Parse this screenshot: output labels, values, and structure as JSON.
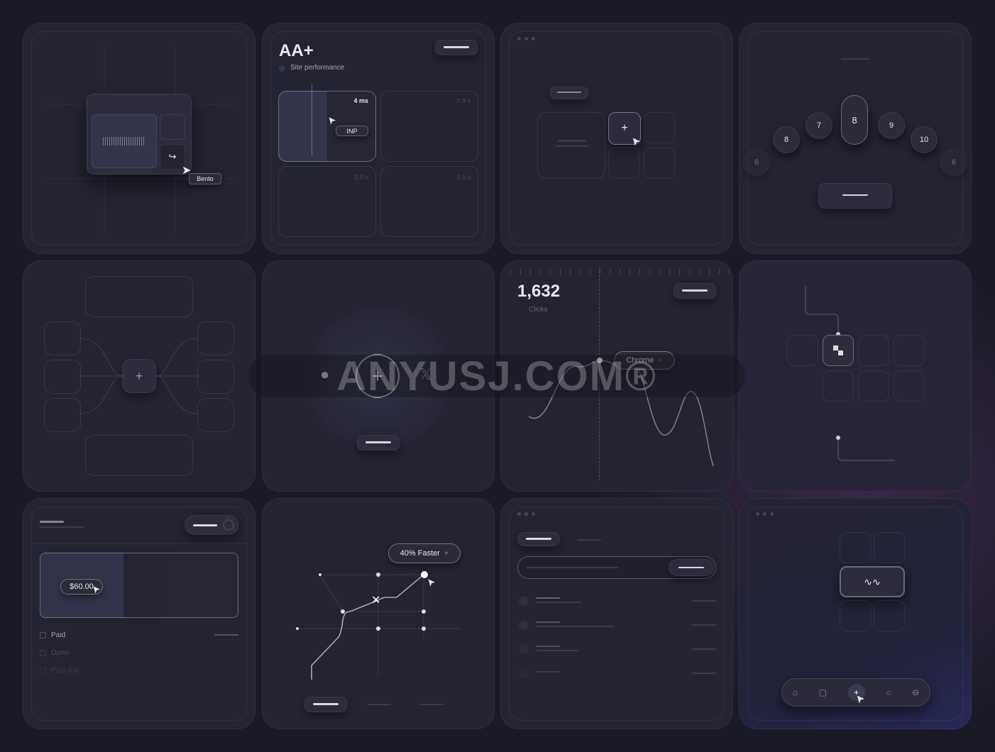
{
  "folder_card": {
    "tag_label": "Bento",
    "icon": "share-icon"
  },
  "performance_card": {
    "grade": "AA+",
    "subtitle": "Site performance",
    "tiles": [
      {
        "value": "4 ms",
        "badge": "INP"
      },
      {
        "value": "0.8 s"
      },
      {
        "value": "2.9 s"
      },
      {
        "value": "2.9 s"
      }
    ]
  },
  "number_picker": {
    "numbers": [
      "6",
      "8",
      "7",
      "8",
      "9",
      "10",
      "6"
    ],
    "selected": "8"
  },
  "integration_card": {
    "icons": [
      "apple-icon",
      "plus-icon",
      "x-icon"
    ]
  },
  "clicks_card": {
    "value": "1,632",
    "label": "Clicks",
    "tooltip": "Chrome"
  },
  "billing_card": {
    "amount": "$60.00",
    "statuses": [
      "Paid",
      "Open",
      "Past due"
    ]
  },
  "route_card": {
    "badge": "40% Faster"
  },
  "dock_card": {
    "icons": [
      "home-icon",
      "sidebar-icon",
      "plus-icon",
      "chat-icon",
      "globe-icon"
    ]
  },
  "watermark": "ANYUSJ.COM®",
  "colors": {
    "background": "#1a1a26",
    "card": "#232332",
    "accent_glow": "#6e3c82"
  }
}
